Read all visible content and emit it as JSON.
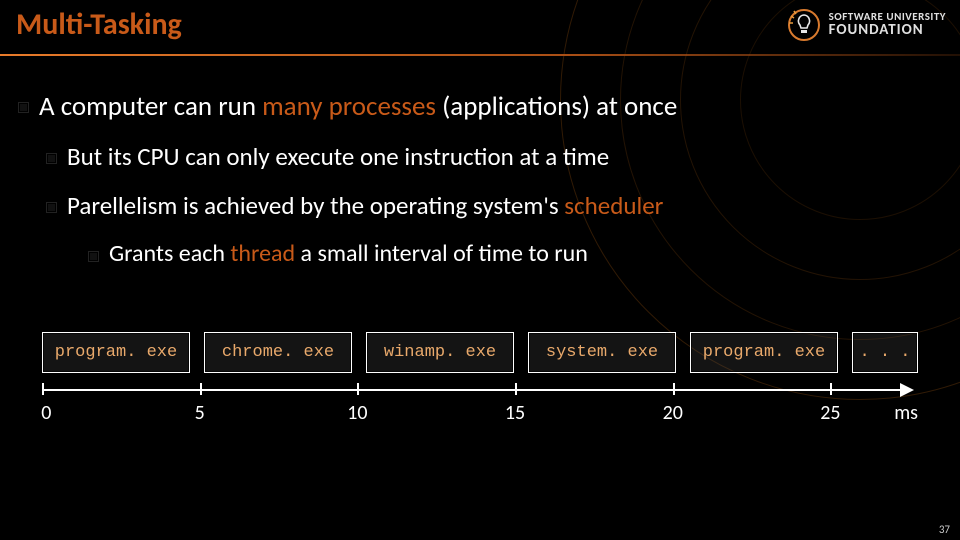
{
  "title": "Multi-Tasking",
  "logo": {
    "line1": "SOFTWARE UNIVERSITY",
    "line2": "FOUNDATION"
  },
  "bullets": {
    "l1_pre": "A computer can run ",
    "l1_hl": "many processes",
    "l1_post": " (applications) at once",
    "l2a": "But its CPU can only execute one instruction at a time",
    "l2b_pre": "Parellelism is achieved by the operating system's ",
    "l2b_hl": "scheduler",
    "l3_pre": "Grants each ",
    "l3_hl": "thread",
    "l3_post": " a small interval of time to run"
  },
  "chart_data": {
    "type": "bar",
    "title": "",
    "xlabel": "ms",
    "ylabel": "",
    "categories": [
      "0–5",
      "5–10",
      "10–15",
      "15–20",
      "20–25",
      "25–…"
    ],
    "series": [
      {
        "name": "process",
        "values": [
          "program. exe",
          "chrome. exe",
          "winamp. exe",
          "system. exe",
          "program. exe",
          ". . ."
        ]
      }
    ],
    "ticks": [
      0,
      5,
      10,
      15,
      20,
      25
    ],
    "xlim": [
      0,
      30
    ],
    "unit": "ms"
  },
  "page_number": "37"
}
